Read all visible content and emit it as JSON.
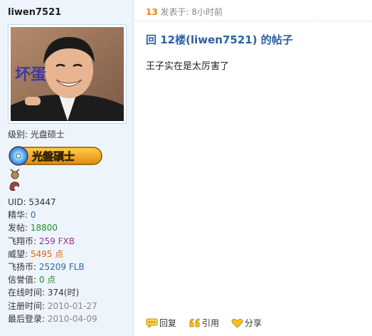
{
  "profile": {
    "username": "liwen7521",
    "avatar_text": "坏蛋",
    "level_label": "级别: ",
    "level_value": "光盘硕士",
    "rank_badge_text": "光盤碩士",
    "stats": [
      {
        "label": "UID: ",
        "value": "53447",
        "color": "#333333"
      },
      {
        "label": "精华: ",
        "value": "0",
        "color": "#3366aa"
      },
      {
        "label": "发帖: ",
        "value": "18800",
        "color": "#2a8a2a"
      },
      {
        "label": "飞翔币: ",
        "value": "259 FXB",
        "color": "#993399"
      },
      {
        "label": "威望: ",
        "value": "5495 点",
        "color": "#e06a00"
      },
      {
        "label": "飞扬币: ",
        "value": "25209 FLB",
        "color": "#3366aa"
      },
      {
        "label": "信誉值: ",
        "value": "0 点",
        "color": "#2a8a2a"
      },
      {
        "label": "在线时间: ",
        "value": "374(时)",
        "color": "#333333"
      },
      {
        "label": "注册时间: ",
        "value": "2010-01-27",
        "color": "#888888"
      },
      {
        "label": "最后登录: ",
        "value": "2010-04-09",
        "color": "#888888"
      }
    ]
  },
  "post": {
    "floor": "13",
    "posted_label": " 发表于: 8小时前",
    "title": "回 12楼(liwen7521) 的帖子",
    "body": "王子实在是太厉害了"
  },
  "actions": {
    "reply": "回复",
    "quote": "引用",
    "share": "分享"
  },
  "colors": {
    "sidebar_bg": "#eef4fb",
    "title_blue": "#2b61a3",
    "floor_orange": "#ff7e00"
  }
}
